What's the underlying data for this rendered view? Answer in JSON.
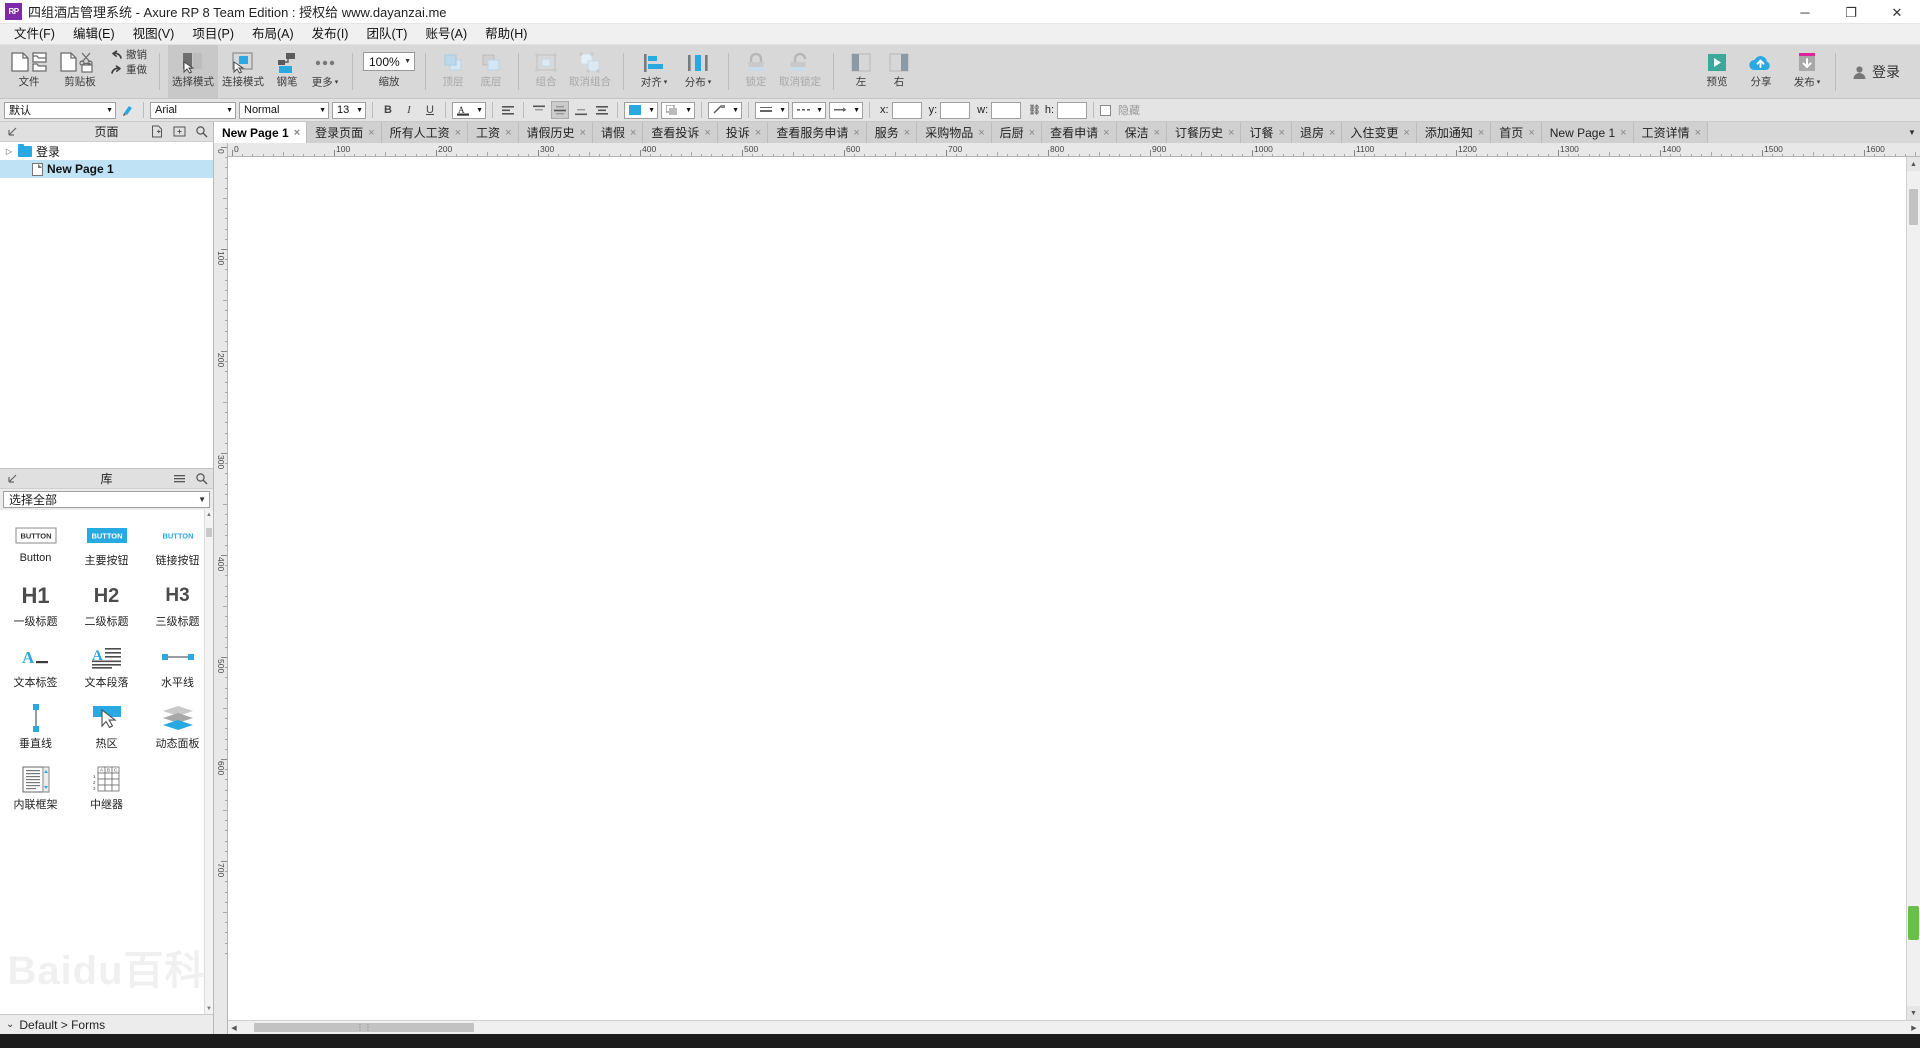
{
  "window": {
    "logo_text": "RP",
    "title": "四组酒店管理系统 - Axure RP 8 Team Edition : 授权给 www.dayanzai.me",
    "controls": {
      "minimize": "─",
      "maximize": "❐",
      "close": "✕"
    }
  },
  "menubar": {
    "items": [
      {
        "label": "文件(F)",
        "name": "menu-file"
      },
      {
        "label": "编辑(E)",
        "name": "menu-edit"
      },
      {
        "label": "视图(V)",
        "name": "menu-view"
      },
      {
        "label": "项目(P)",
        "name": "menu-project"
      },
      {
        "label": "布局(A)",
        "name": "menu-layout"
      },
      {
        "label": "发布(I)",
        "name": "menu-publish"
      },
      {
        "label": "团队(T)",
        "name": "menu-team"
      },
      {
        "label": "账号(A)",
        "name": "menu-account"
      },
      {
        "label": "帮助(H)",
        "name": "menu-help"
      }
    ]
  },
  "toolbar": {
    "file_label": "文件",
    "clipboard_label": "剪贴板",
    "undo_label": "撤销",
    "redo_label": "重做",
    "select_mode_label": "选择模式",
    "connect_mode_label": "连接模式",
    "pen_label": "钢笔",
    "more_label": "更多",
    "zoom_label": "缩放",
    "zoom_value": "100%",
    "bring_front_label": "顶层",
    "send_back_label": "底层",
    "group_label": "组合",
    "ungroup_label": "取消组合",
    "align_label": "对齐",
    "distribute_label": "分布",
    "lock_label": "锁定",
    "unlock_label": "取消锁定",
    "left_label": "左",
    "right_label": "右",
    "preview_label": "预览",
    "share_label": "分享",
    "publish_label": "发布",
    "login_label": "登录",
    "caret": "▾",
    "colors": {
      "accent_blue": "#29a9e1",
      "preview_green": "#3aa99a",
      "publish_pink": "#e0249a"
    }
  },
  "formatbar": {
    "style_value": "默认",
    "font_value": "Arial",
    "weight_value": "Normal",
    "size_value": "13",
    "bold": "B",
    "italic": "I",
    "underline": "U",
    "more": "▾",
    "x_label": "x:",
    "y_label": "y:",
    "w_label": "w:",
    "h_label": "h:",
    "x_value": "",
    "y_value": "",
    "w_value": "",
    "h_value": "",
    "hidden_label": "隐藏",
    "link_icon": "🔗"
  },
  "pages_panel": {
    "title": "页面",
    "add_page_icon": "add-page-icon",
    "add_folder_icon": "add-folder-icon",
    "search_icon": "search-icon",
    "tree": [
      {
        "label": "登录",
        "type": "folder",
        "depth": 0,
        "selected": false,
        "expander": "▷"
      },
      {
        "label": "New Page 1",
        "type": "page",
        "depth": 1,
        "selected": true,
        "expander": ""
      }
    ]
  },
  "library_panel": {
    "title": "库",
    "menu_icon": "hamburger-icon",
    "search_icon": "search-icon",
    "filter_value": "选择全部",
    "filter_caret": "▼",
    "items": [
      {
        "label": "Button",
        "icon": "button-outline-icon",
        "badge": "BUTTON"
      },
      {
        "label": "主要按钮",
        "icon": "primary-button-icon",
        "badge": "BUTTON"
      },
      {
        "label": "链接按钮",
        "icon": "link-button-icon",
        "badge": "BUTTON"
      },
      {
        "label": "一级标题",
        "icon": "heading1-icon",
        "badge": "H1"
      },
      {
        "label": "二级标题",
        "icon": "heading2-icon",
        "badge": "H2"
      },
      {
        "label": "三级标题",
        "icon": "heading3-icon",
        "badge": "H3"
      },
      {
        "label": "文本标签",
        "icon": "text-label-icon",
        "badge": "A"
      },
      {
        "label": "文本段落",
        "icon": "text-paragraph-icon",
        "badge": "A"
      },
      {
        "label": "水平线",
        "icon": "horizontal-line-icon",
        "badge": ""
      },
      {
        "label": "垂直线",
        "icon": "vertical-line-icon",
        "badge": ""
      },
      {
        "label": "热区",
        "icon": "hotspot-icon",
        "badge": ""
      },
      {
        "label": "动态面板",
        "icon": "dynamic-panel-icon",
        "badge": ""
      },
      {
        "label": "内联框架",
        "icon": "inline-frame-icon",
        "badge": ""
      },
      {
        "label": "中继器",
        "icon": "repeater-icon",
        "badge": ""
      }
    ],
    "footer_label": "Default > Forms",
    "footer_caret": "⌄",
    "watermark": "Baidu百科"
  },
  "tabs": {
    "items": [
      {
        "label": "New Page 1",
        "active": true
      },
      {
        "label": "登录页面",
        "active": false
      },
      {
        "label": "所有人工资",
        "active": false
      },
      {
        "label": "工资",
        "active": false
      },
      {
        "label": "请假历史",
        "active": false
      },
      {
        "label": "请假",
        "active": false
      },
      {
        "label": "查看投诉",
        "active": false
      },
      {
        "label": "投诉",
        "active": false
      },
      {
        "label": "查看服务申请",
        "active": false
      },
      {
        "label": "服务",
        "active": false
      },
      {
        "label": "采购物品",
        "active": false
      },
      {
        "label": "后厨",
        "active": false
      },
      {
        "label": "查看申请",
        "active": false
      },
      {
        "label": "保洁",
        "active": false
      },
      {
        "label": "订餐历史",
        "active": false
      },
      {
        "label": "订餐",
        "active": false
      },
      {
        "label": "退房",
        "active": false
      },
      {
        "label": "入住变更",
        "active": false
      },
      {
        "label": "添加通知",
        "active": false
      },
      {
        "label": "首页",
        "active": false
      },
      {
        "label": "New Page 1",
        "active": false
      },
      {
        "label": "工资详情",
        "active": false
      }
    ],
    "close_glyph": "×",
    "overflow_glyph": "▼"
  },
  "rulers": {
    "h_labels": [
      "0",
      "100",
      "200",
      "300",
      "400",
      "500",
      "600",
      "700",
      "800",
      "900",
      "1000",
      "1100",
      "1200",
      "1300",
      "1400",
      "1500",
      "1600"
    ],
    "v_labels": [
      "0",
      "100",
      "200",
      "300",
      "400",
      "500",
      "600",
      "700"
    ]
  },
  "scrollbars": {
    "up_arrow": "▲",
    "down_arrow": "▼",
    "left_arrow": "◀",
    "right_arrow": "▶",
    "grip": "⋮⋮"
  },
  "taskbar": {
    "clock": ""
  }
}
